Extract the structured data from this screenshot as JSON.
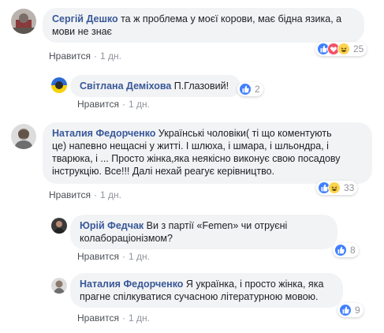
{
  "comments": [
    {
      "author": "Сергій Дешко",
      "text_line1": " та ж проблема у моєї корови, має бідна язика, а",
      "text_line2": "мови не знає",
      "like_label": "Нравится",
      "time": "1 дн.",
      "reaction_count": "25",
      "reactions": [
        "like-icon",
        "love-icon",
        "haha-icon"
      ]
    },
    {
      "author": "Світлана Деміхова",
      "text": " П.Глазовий!",
      "like_label": "Нравится",
      "time": "1 дн.",
      "reaction_count": "2",
      "reactions": [
        "like-icon"
      ]
    },
    {
      "author": "Наталия Федорченко",
      "text_line1": " Українські чоловіки( ті що коментують",
      "text_line2": "це) напевно нещасні у житті. І шлюха, і шмара, і шльондра, і",
      "text_line3": "тварюка, і ... Просто жінка,яка неякісно виконує свою посадову",
      "text_line4": "інструкцію. Все!!! Далі нехай реагує керівництво.",
      "like_label": "Нравится",
      "time": "1 дн.",
      "reaction_count": "33",
      "reactions": [
        "like-icon",
        "haha-icon"
      ]
    },
    {
      "author": "Юрій Федчак",
      "text_line1": " Ви з партії «Femen» чи отруєні",
      "text_line2": "колабораціонізмом?",
      "like_label": "Нравится",
      "time": "1 дн.",
      "reaction_count": "8",
      "reactions": [
        "like-icon"
      ]
    },
    {
      "author": "Наталия Федорченко",
      "text_line1": " Я українка, і просто жінка, яка",
      "text_line2": "прагне спілкуватися сучасною літературною мовою.",
      "like_label": "Нравится",
      "time": "1 дн.",
      "reaction_count": "9",
      "reactions": [
        "like-icon"
      ]
    }
  ],
  "separator": "·",
  "colors": {
    "author": "#385898",
    "bubble": "#f2f3f5",
    "meta": "#90949c",
    "like_blue": "#4080ff",
    "love_red": "#f25268",
    "haha_yellow": "#fcd34d"
  }
}
